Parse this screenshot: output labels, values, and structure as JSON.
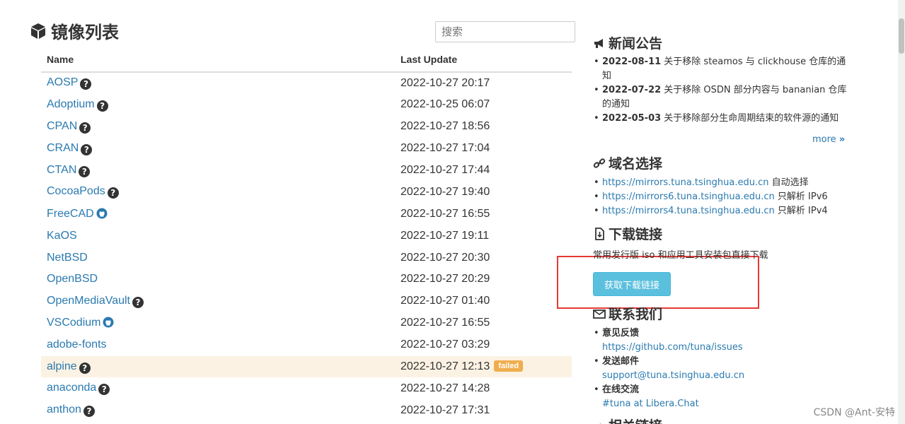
{
  "page_title": "镜像列表",
  "search": {
    "placeholder": "搜索"
  },
  "table": {
    "headers": {
      "name": "Name",
      "last_update": "Last Update"
    },
    "rows": [
      {
        "name": "AOSP",
        "date": "2022-10-27 20:17",
        "icon": "help-icon"
      },
      {
        "name": "Adoptium",
        "date": "2022-10-25 06:07",
        "icon": "help-icon"
      },
      {
        "name": "CPAN",
        "date": "2022-10-27 18:56",
        "icon": "help-icon"
      },
      {
        "name": "CRAN",
        "date": "2022-10-27 17:04",
        "icon": "help-icon"
      },
      {
        "name": "CTAN",
        "date": "2022-10-27 17:44",
        "icon": "help-icon"
      },
      {
        "name": "CocoaPods",
        "date": "2022-10-27 19:40",
        "icon": "help-icon"
      },
      {
        "name": "FreeCAD",
        "date": "2022-10-27 16:55",
        "icon": "github-icon"
      },
      {
        "name": "KaOS",
        "date": "2022-10-27 19:11",
        "icon": ""
      },
      {
        "name": "NetBSD",
        "date": "2022-10-27 20:30",
        "icon": ""
      },
      {
        "name": "OpenBSD",
        "date": "2022-10-27 20:29",
        "icon": ""
      },
      {
        "name": "OpenMediaVault",
        "date": "2022-10-27 01:40",
        "icon": "help-icon"
      },
      {
        "name": "VSCodium",
        "date": "2022-10-27 16:55",
        "icon": "github-icon"
      },
      {
        "name": "adobe-fonts",
        "date": "2022-10-27 03:29",
        "icon": ""
      },
      {
        "name": "alpine",
        "date": "2022-10-27 12:13",
        "icon": "help-icon",
        "status": "failed"
      },
      {
        "name": "anaconda",
        "date": "2022-10-27 14:28",
        "icon": "help-icon"
      },
      {
        "name": "anthon",
        "date": "2022-10-27 17:31",
        "icon": "help-icon"
      }
    ]
  },
  "news": {
    "title": "新闻公告",
    "items": [
      {
        "date": "2022-08-11",
        "text": "关于移除 steamos 与 clickhouse 仓库的通知"
      },
      {
        "date": "2022-07-22",
        "text": "关于移除 OSDN 部分内容与 bananian 仓库的通知"
      },
      {
        "date": "2022-05-03",
        "text": "关于移除部分生命周期结束的软件源的通知"
      }
    ],
    "more": "more"
  },
  "domains": {
    "title": "域名选择",
    "items": [
      {
        "url": "https://mirrors.tuna.tsinghua.edu.cn",
        "note": "自动选择"
      },
      {
        "url": "https://mirrors6.tuna.tsinghua.edu.cn",
        "note": "只解析 IPv6"
      },
      {
        "url": "https://mirrors4.tuna.tsinghua.edu.cn",
        "note": "只解析 IPv4"
      }
    ]
  },
  "downloads": {
    "title": "下载链接",
    "description": "常用发行版 iso 和应用工具安装包直接下载",
    "button": "获取下载链接"
  },
  "contact": {
    "title": "联系我们",
    "items": [
      {
        "label": "意见反馈",
        "link": "https://github.com/tuna/issues"
      },
      {
        "label": "发送邮件",
        "link": "support@tuna.tsinghua.edu.cn"
      },
      {
        "label": "在线交流",
        "link": "#tuna at Libera.Chat"
      }
    ]
  },
  "related": {
    "title": "相关链接"
  },
  "watermark": "CSDN @Ant-安特",
  "colors": {
    "link": "#2a7ab0",
    "button": "#5bc0de",
    "badge": "#f0ad4e",
    "highlight": "#e53935"
  }
}
